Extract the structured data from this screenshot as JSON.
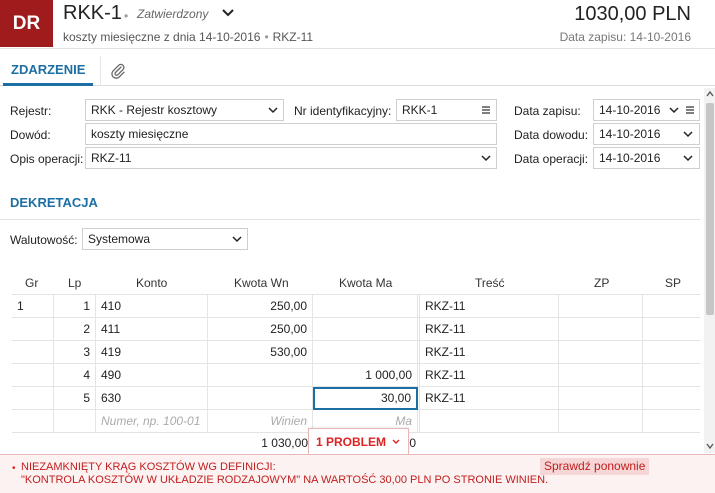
{
  "header": {
    "badge": "DR",
    "title": "RKK-1",
    "status": "Zatwierdzony",
    "subtitle_desc": "koszty miesięczne z dnia 14-10-2016",
    "subtitle_code": "RKZ-11",
    "amount": "1030,00 PLN",
    "save_date": "Data zapisu: 14-10-2016"
  },
  "tabs": {
    "active": "ZDARZENIE",
    "attachment_icon": "paperclip-icon"
  },
  "form": {
    "rejestr_label": "Rejestr:",
    "rejestr_value": "RKK - Rejestr kosztowy",
    "nr_label": "Nr identyfikacyjny:",
    "nr_value": "RKK-1",
    "data_zapisu_label": "Data zapisu:",
    "data_zapisu_value": "14-10-2016",
    "dowod_label": "Dowód:",
    "dowod_value": "koszty miesięczne",
    "data_dowodu_label": "Data dowodu:",
    "data_dowodu_value": "14-10-2016",
    "opis_label": "Opis operacji:",
    "opis_value": "RKZ-11",
    "data_operacji_label": "Data operacji:",
    "data_operacji_value": "14-10-2016"
  },
  "dekretacja": {
    "title": "DEKRETACJA",
    "walutowosc_label": "Walutowość:",
    "walutowosc_value": "Systemowa",
    "columns": [
      "Gr",
      "Lp",
      "Konto",
      "Kwota Wn",
      "Kwota Ma",
      "Treść",
      "ZP",
      "SP"
    ],
    "rows": [
      {
        "gr": "1",
        "lp": "1",
        "konto": "410",
        "wn": "250,00",
        "ma": "",
        "tresc": "RKZ-11"
      },
      {
        "gr": "",
        "lp": "2",
        "konto": "411",
        "wn": "250,00",
        "ma": "",
        "tresc": "RKZ-11"
      },
      {
        "gr": "",
        "lp": "3",
        "konto": "419",
        "wn": "530,00",
        "ma": "",
        "tresc": "RKZ-11"
      },
      {
        "gr": "",
        "lp": "4",
        "konto": "490",
        "wn": "",
        "ma": "1 000,00",
        "tresc": "RKZ-11"
      },
      {
        "gr": "",
        "lp": "5",
        "konto": "630",
        "wn": "",
        "ma": "30,00",
        "tresc": "RKZ-11"
      }
    ],
    "new_row": {
      "konto_placeholder": "Numer, np. 100-01",
      "wn_placeholder": "Winien",
      "ma_placeholder": "Ma"
    },
    "sum_wn": "1 030,00",
    "sum_ma_fragment": "0"
  },
  "problem": {
    "button_label": "1 PROBLEM",
    "error_line1": "NIEZAMKNIĘTY KRĄG KOSZTÓW WG DEFINICJI:",
    "error_line2": "\"KONTROLA KOSZTÓW W UKŁADZIE RODZAJOWYM\" NA WARTOŚĆ 30,00 PLN PO STRONIE WINIEN.",
    "recheck_label": "Sprawdź ponownie"
  },
  "colors": {
    "badge": "#a01c1c",
    "accent": "#1d6fa3",
    "error": "#c01e1e"
  }
}
